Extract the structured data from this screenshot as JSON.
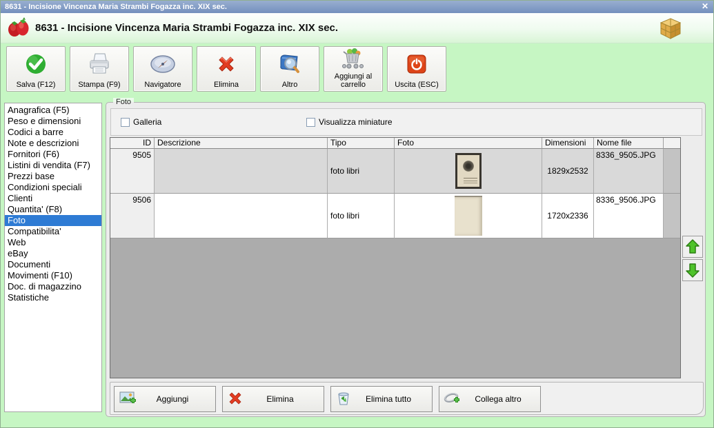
{
  "titlebar": {
    "title": "8631 - Incisione Vincenza Maria Strambi Fogazza inc. XIX sec.",
    "close_glyph": "✕"
  },
  "header": {
    "title": "8631 - Incisione Vincenza Maria Strambi Fogazza inc. XIX sec."
  },
  "toolbar": {
    "buttons": [
      {
        "label": "Salva (F12)",
        "icon": "save-icon"
      },
      {
        "label": "Stampa (F9)",
        "icon": "printer-icon"
      },
      {
        "label": "Navigatore",
        "icon": "compass-icon"
      },
      {
        "label": "Elimina",
        "icon": "delete-icon"
      },
      {
        "label": "Altro",
        "icon": "book-search-icon"
      },
      {
        "label": "Aggiungi al carrello",
        "icon": "cart-icon"
      },
      {
        "label": "Uscita (ESC)",
        "icon": "power-icon"
      }
    ]
  },
  "sidebar": {
    "items": [
      "Anagrafica (F5)",
      "Peso e dimensioni",
      "Codici a barre",
      "Note e descrizioni",
      "Fornitori (F6)",
      "Listini di vendita (F7)",
      "Prezzi base",
      "Condizioni speciali",
      "Clienti",
      "Quantita' (F8)",
      "Foto",
      "Compatibilita'",
      "Web",
      "eBay",
      "Documenti",
      "Movimenti (F10)",
      "Doc. di magazzino",
      "Statistiche"
    ],
    "selected": "Foto"
  },
  "foto": {
    "groupbox_label": "Foto",
    "galleria_label": "Galleria",
    "miniature_label": "Visualizza miniature",
    "galleria_checked": false,
    "miniature_checked": false,
    "table": {
      "columns": {
        "id": "ID",
        "descrizione": "Descrizione",
        "tipo": "Tipo",
        "foto": "Foto",
        "dimensioni": "Dimensioni",
        "nome_file": "Nome file"
      },
      "rows": [
        {
          "id": "9505",
          "descrizione": "",
          "tipo": "foto libri",
          "dimensioni": "1829x2532",
          "nome_file": "8336_9505.JPG",
          "selected": true
        },
        {
          "id": "9506",
          "descrizione": "",
          "tipo": "foto libri",
          "dimensioni": "1720x2336",
          "nome_file": "8336_9506.JPG",
          "selected": false
        }
      ]
    },
    "actions": {
      "aggiungi": "Aggiungi",
      "elimina": "Elimina",
      "elimina_tutto": "Elimina tutto",
      "collega_altro": "Collega altro"
    }
  },
  "colors": {
    "titlebar_blue": "#7f9ac5",
    "window_green": "#c6f6c3",
    "selection_blue": "#2e7bd4",
    "selected_row_gray": "#d9d9d9",
    "grid_empty_gray": "#acacac"
  }
}
